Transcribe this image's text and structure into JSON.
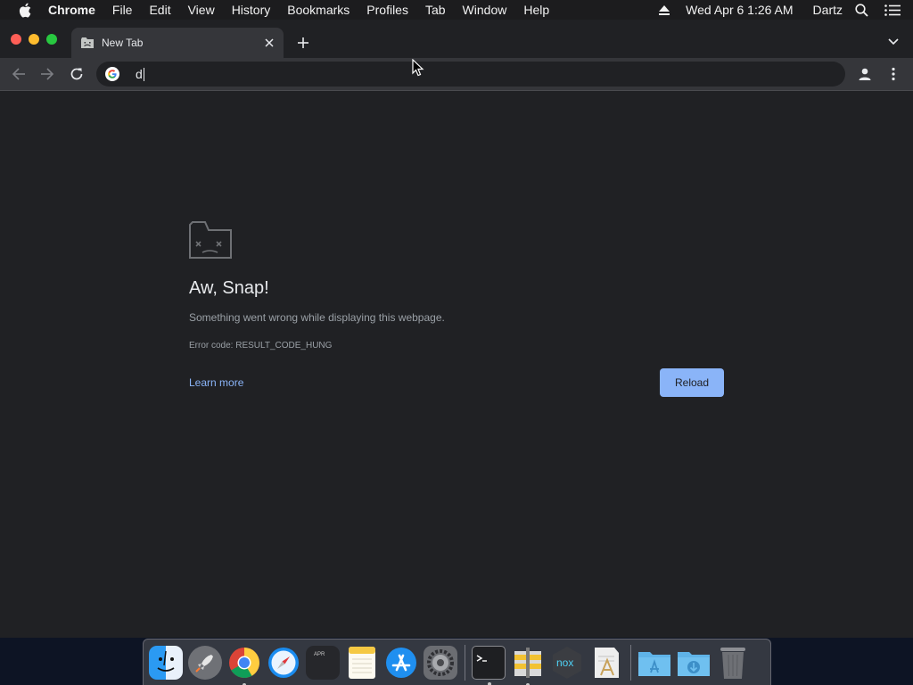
{
  "menubar": {
    "app_name": "Chrome",
    "menus": [
      "File",
      "Edit",
      "View",
      "History",
      "Bookmarks",
      "Profiles",
      "Tab",
      "Window",
      "Help"
    ],
    "datetime": "Wed Apr 6  1:26 AM",
    "user": "Dartz",
    "icons": [
      "apple-icon",
      "eject-icon",
      "spotlight-icon",
      "control-center-icon"
    ]
  },
  "window": {
    "tab_title": "New Tab",
    "omnibox_text": "d"
  },
  "error_page": {
    "title": "Aw, Snap!",
    "message": "Something went wrong while displaying this webpage.",
    "error_code": "Error code: RESULT_CODE_HUNG",
    "learn_more": "Learn more",
    "reload_label": "Reload"
  },
  "dock": {
    "apps": [
      {
        "name": "Finder",
        "icon": "finder-icon",
        "running": false
      },
      {
        "name": "Launchpad",
        "icon": "launchpad-icon",
        "running": false
      },
      {
        "name": "Google Chrome",
        "icon": "chrome-icon",
        "running": true
      },
      {
        "name": "Safari",
        "icon": "safari-icon",
        "running": false
      },
      {
        "name": "Calendar",
        "icon": "calendar-icon",
        "running": false,
        "label": "APR"
      },
      {
        "name": "Notes",
        "icon": "notes-icon",
        "running": false
      },
      {
        "name": "App Store",
        "icon": "app-store-icon",
        "running": false
      },
      {
        "name": "System Preferences",
        "icon": "system-preferences-icon",
        "running": false
      },
      {
        "name": "Terminal",
        "icon": "terminal-icon",
        "running": true
      },
      {
        "name": "Archive Utility",
        "icon": "archive-utility-icon",
        "running": true
      },
      {
        "name": "Nox",
        "icon": "nox-icon",
        "running": false,
        "label": "nox"
      },
      {
        "name": "Script Editor",
        "icon": "script-editor-icon",
        "running": false
      },
      {
        "name": "Applications",
        "icon": "applications-folder-icon",
        "running": false
      },
      {
        "name": "Downloads",
        "icon": "downloads-folder-icon",
        "running": false
      },
      {
        "name": "Trash",
        "icon": "trash-icon",
        "running": false
      }
    ]
  },
  "colors": {
    "window_bg": "#202124",
    "toolbar_bg": "#35363a",
    "link": "#8ab4f8",
    "button_bg": "#8ab4f8"
  }
}
